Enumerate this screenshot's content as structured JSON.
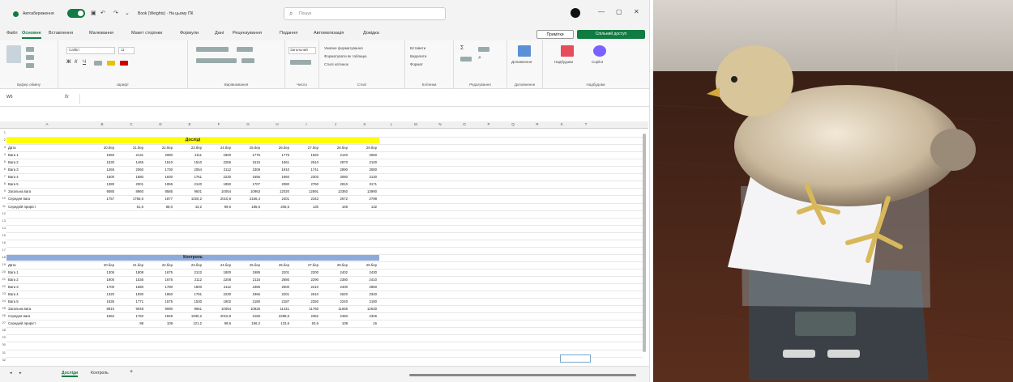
{
  "titlebar": {
    "autosave_label": "Автозбереження",
    "doc_title": "Book (Weights) · На цьому ПК",
    "search_placeholder": "Пошук"
  },
  "menu": {
    "tabs": [
      "Файл",
      "Основне",
      "Вставлення",
      "Малювання",
      "Макет сторінки",
      "Формули",
      "Дані",
      "Рецензування",
      "Подання",
      "Автоматизація",
      "Довідка"
    ],
    "active": "Основне",
    "comments_label": "Примітки",
    "share_label": "Спільний доступ"
  },
  "ribbon": {
    "groups": [
      "Буфер обміну",
      "Шрифт",
      "Вирівнювання",
      "Число",
      "Стилі",
      "Клітинки",
      "Редагування",
      "Доповнення",
      "Надбудови"
    ],
    "font_name": "Calibri",
    "font_size": "11",
    "number_format": "Загальний",
    "styles": [
      "Умовне форматування",
      "Форматувати як таблицю",
      "Стилі клітинок"
    ],
    "cells": [
      "Вставити",
      "Видалити",
      "Формат"
    ],
    "addins_labels": [
      "Доповнення",
      "Надбудови",
      "Copilot"
    ]
  },
  "formula_bar": {
    "name_box": "W6",
    "fx": "fx",
    "value": ""
  },
  "sheet": {
    "columns": [
      "A",
      "B",
      "C",
      "D",
      "E",
      "F",
      "G",
      "H",
      "I",
      "J",
      "K",
      "L",
      "M",
      "N",
      "O",
      "P",
      "Q",
      "R",
      "S",
      "T"
    ],
    "rows": [
      "1",
      "2",
      "3",
      "4",
      "5",
      "6",
      "7",
      "8",
      "9",
      "10",
      "11",
      "12",
      "13",
      "14",
      "15",
      "16",
      "17",
      "18",
      "19",
      "20",
      "21",
      "22",
      "23",
      "24",
      "25",
      "26",
      "27",
      "28",
      "29",
      "30",
      "31",
      "32"
    ],
    "table1": {
      "title": "Досліді",
      "dates": [
        "20.бер",
        "21.бер",
        "22.бер",
        "23.бер",
        "24.бер",
        "25.бер",
        "26.бер",
        "27.бер",
        "28.бер",
        "29.бер"
      ],
      "rows": [
        {
          "label": "Дата",
          "values": []
        },
        {
          "label": "Вага 1",
          "values": [
            "1950",
            "2131",
            "2080",
            "2111",
            "1800",
            "1776",
            "1775",
            "1920",
            "2120",
            "2060"
          ]
        },
        {
          "label": "Вага 2",
          "values": [
            "1530",
            "1465",
            "1510",
            "1510",
            "2265",
            "1515",
            "1561",
            "2610",
            "2870",
            "2100"
          ]
        },
        {
          "label": "Вага 3",
          "values": [
            "1265",
            "2060",
            "1730",
            "2054",
            "2112",
            "2309",
            "1910",
            "1741",
            "2990",
            "3080"
          ]
        },
        {
          "label": "Вага 4",
          "values": [
            "1600",
            "1880",
            "1930",
            "1761",
            "2230",
            "1656",
            "1960",
            "2303",
            "3080",
            "3130"
          ]
        },
        {
          "label": "Вага 5",
          "values": [
            "1380",
            "2001",
            "1955",
            "2120",
            "1850",
            "1707",
            "2080",
            "2760",
            "2810",
            "3171"
          ]
        },
        {
          "label": "Загальна вага",
          "values": [
            "9085",
            "8960",
            "8585",
            "9601",
            "10054",
            "10963",
            "12020",
            "12891",
            "13360",
            "13990"
          ]
        },
        {
          "label": "Середня вага",
          "values": [
            "1757",
            "1766,6",
            "1877",
            "1020,2",
            "2010,8",
            "2156,4",
            "2401",
            "2342",
            "2672",
            "2798"
          ]
        },
        {
          "label": "Середній приріст",
          "values": [
            "",
            "51,6",
            "88,0",
            "43,2",
            "99,6",
            "185,6",
            "205,6",
            "130",
            "169",
            "132"
          ]
        }
      ]
    },
    "table2": {
      "title": "Контроль",
      "dates": [
        "20.бер",
        "21.бер",
        "22.бер",
        "23.бер",
        "24.бер",
        "25.бер",
        "26.бер",
        "27.бер",
        "28.бер",
        "29.бер"
      ],
      "rows": [
        {
          "label": "Дата",
          "values": []
        },
        {
          "label": "Вага 1",
          "values": [
            "1305",
            "1808",
            "1675",
            "2122",
            "1800",
            "1985",
            "2201",
            "2200",
            "2402",
            "2430"
          ]
        },
        {
          "label": "Вага 2",
          "values": [
            "1900",
            "1535",
            "1675",
            "2112",
            "2208",
            "2116",
            "2680",
            "2290",
            "2380",
            "2410"
          ]
        },
        {
          "label": "Вага 3",
          "values": [
            "1700",
            "1680",
            "1780",
            "1800",
            "2112",
            "2385",
            "2600",
            "2210",
            "2400",
            "2960"
          ]
        },
        {
          "label": "Вага 4",
          "values": [
            "1320",
            "1930",
            "1860",
            "1781",
            "2230",
            "1966",
            "2201",
            "2610",
            "2620",
            "2340"
          ]
        },
        {
          "label": "Вага 5",
          "values": [
            "1635",
            "1771",
            "1575",
            "1530",
            "1802",
            "2180",
            "2187",
            "2250",
            "2240",
            "2180"
          ]
        },
        {
          "label": "Загальна вага",
          "values": [
            "8910",
            "9048",
            "9080",
            "9661",
            "10054",
            "10825",
            "11441",
            "11760",
            "11655",
            "12630"
          ]
        },
        {
          "label": "Середня вага",
          "values": [
            "1662",
            "1760",
            "1849",
            "1930,2",
            "2010,8",
            "2165",
            "2288,6",
            "2352",
            "2460",
            "2326"
          ]
        },
        {
          "label": "Середній приріст",
          "values": [
            "",
            "98",
            "108",
            "121,2",
            "99,6",
            "156,2",
            "123,6",
            "63,6",
            "108",
            "16"
          ]
        }
      ]
    },
    "tabs": [
      "Досліди",
      "Контроль"
    ],
    "active_tab": "Досліди"
  },
  "colors": {
    "excel_green": "#107c41",
    "table1_header": "#ffff00",
    "table2_header": "#8eaadb"
  }
}
